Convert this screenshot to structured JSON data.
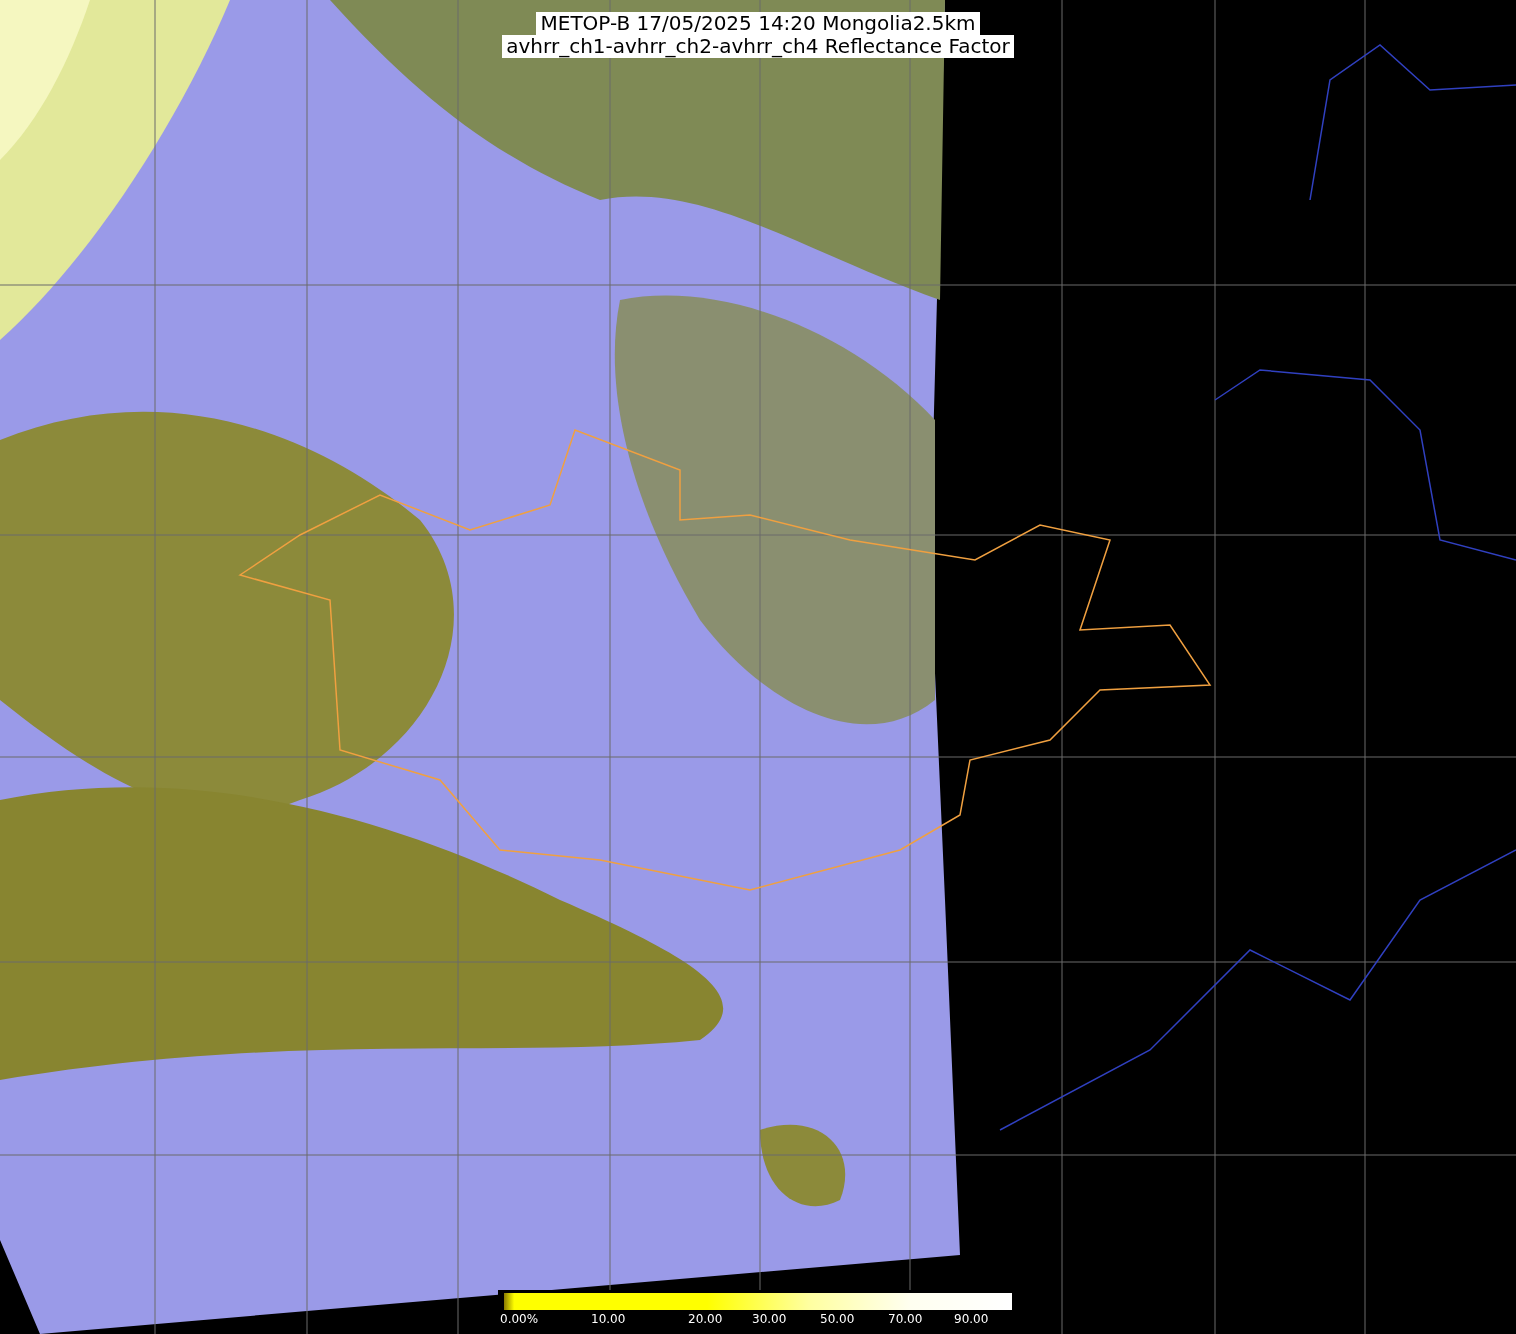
{
  "title": {
    "lines": [
      "METOP-B 17/05/2025 14:20 Mongolia2.5km",
      "avhrr_ch1-avhrr_ch2-avhrr_ch4 Reflectance Factor"
    ]
  },
  "colorbar": {
    "labels": [
      "0.00%",
      "10.00",
      "20.00",
      "30.00",
      "50.00",
      "70.00",
      "90.00"
    ]
  }
}
